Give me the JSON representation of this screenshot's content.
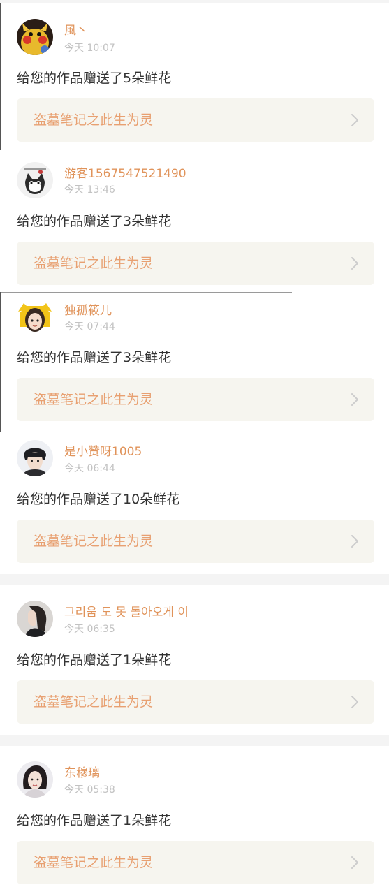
{
  "items": [
    {
      "username": "風丶",
      "time": "今天 10:07",
      "message": "给您的作品赠送了5朵鲜花",
      "work_title": "盗墓笔记之此生为灵",
      "avatar_icon": "pikachu-avatar-icon"
    },
    {
      "username": "游客1567547521490",
      "time": "今天 13:46",
      "message": "给您的作品赠送了3朵鲜花",
      "work_title": "盗墓笔记之此生为灵",
      "avatar_icon": "cat-avatar-icon"
    },
    {
      "username": "独孤筱儿",
      "time": "今天 07:44",
      "message": "给您的作品赠送了3朵鲜花",
      "work_title": "盗墓笔记之此生为灵",
      "avatar_icon": "cartoon-girl-avatar-icon"
    },
    {
      "username": "是小赞呀1005",
      "time": "今天 06:44",
      "message": "给您的作品赠送了10朵鲜花",
      "work_title": "盗墓笔记之此生为灵",
      "avatar_icon": "boy-portrait-avatar-icon"
    },
    {
      "username": "그리움 도 못 돌아오게 이",
      "time": "今天 06:35",
      "message": "给您的作品赠送了1朵鲜花",
      "work_title": "盗墓笔记之此生为灵",
      "avatar_icon": "profile-girl-avatar-icon"
    },
    {
      "username": "东穆璃",
      "time": "今天 05:38",
      "message": "给您的作品赠送了1朵鲜花",
      "work_title": "盗墓笔记之此生为灵",
      "avatar_icon": "woman-portrait-avatar-icon"
    }
  ],
  "colors": {
    "username": "#e0935a",
    "time": "#c2c2c2",
    "message": "#333333",
    "work_title": "#e8a071",
    "work_bg": "#f6f5ef",
    "separator": "#f4f4f4"
  }
}
